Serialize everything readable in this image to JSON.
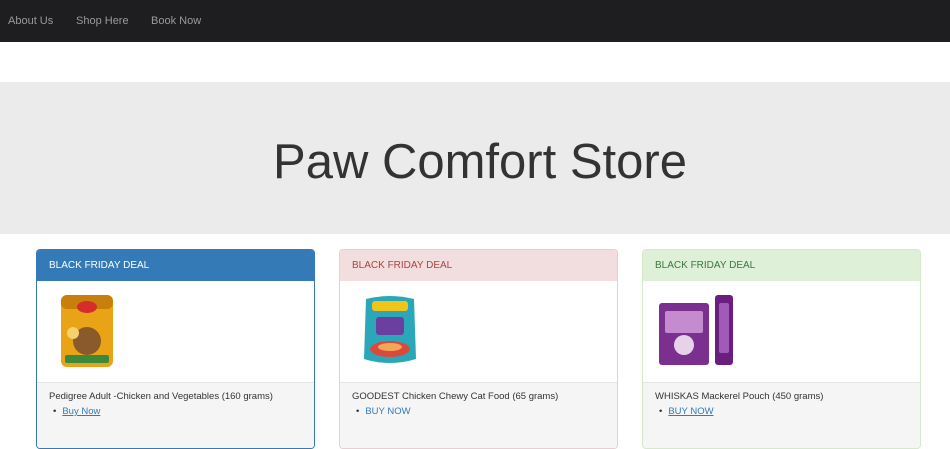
{
  "nav": {
    "links": [
      "About Us",
      "Shop Here",
      "Book Now"
    ]
  },
  "hero": {
    "title": "Paw Comfort Store"
  },
  "products": [
    {
      "badge": "BLACK FRIDAY DEAL",
      "name": "Pedigree Adult -Chicken and Vegetables (160 grams)",
      "buy_label": "Buy Now"
    },
    {
      "badge": "BLACK FRIDAY DEAL",
      "name": "GOODEST Chicken Chewy Cat Food (65 grams)",
      "buy_label": "BUY NOW"
    },
    {
      "badge": "BLACK FRIDAY DEAL",
      "name": "WHISKAS Mackerel Pouch (450 grams)",
      "buy_label": "BUY NOW"
    }
  ],
  "colors": {
    "navbar": "#1e1e20",
    "jumbotron": "#ebebeb",
    "primary": "#337ab7",
    "danger_bg": "#f2dede",
    "success_bg": "#dff0d8"
  }
}
